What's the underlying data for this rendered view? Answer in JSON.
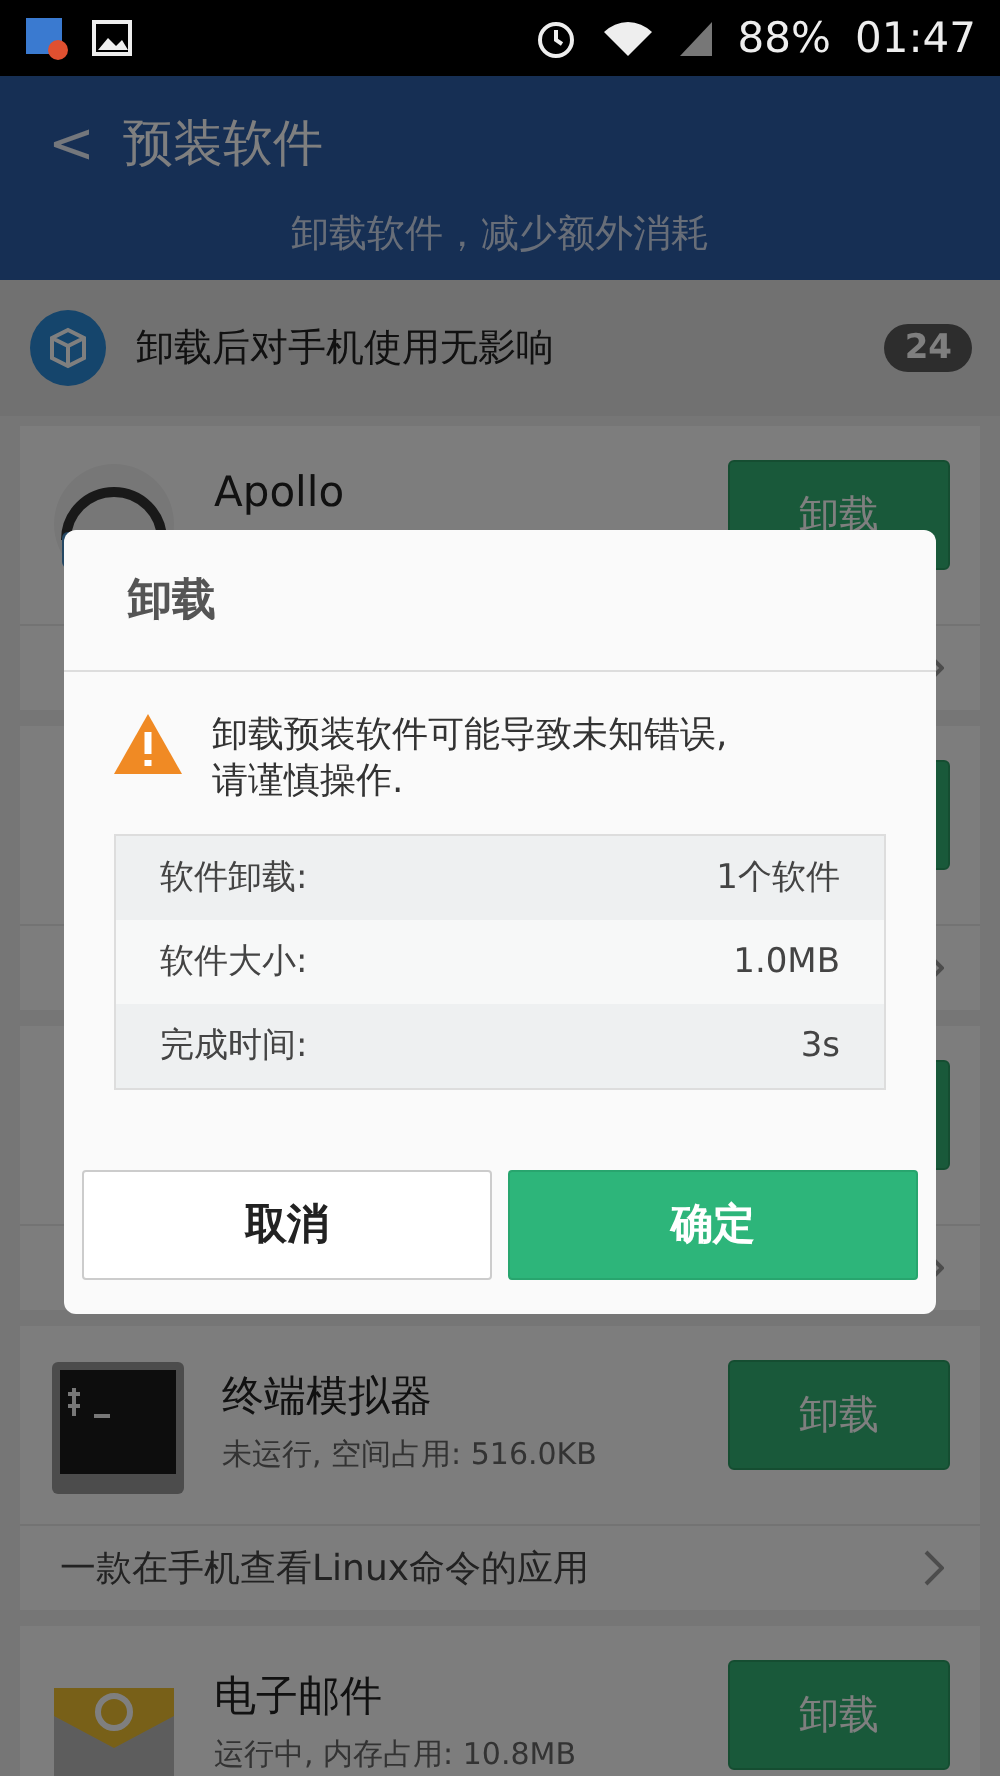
{
  "status_bar": {
    "battery": "88%",
    "time": "01:47"
  },
  "header": {
    "back": "<",
    "title": "预装软件",
    "subtitle": "卸载软件，减少额外消耗"
  },
  "section": {
    "title": "卸载后对手机使用无影响",
    "count": "24"
  },
  "apps": [
    {
      "kind": "headphones",
      "name": "Apollo",
      "button": "卸载"
    },
    {
      "kind": "covered"
    },
    {
      "kind": "covered"
    },
    {
      "kind": "terminal",
      "name": "终端模拟器",
      "detail": "未运行, 空间占用: 516.0KB",
      "button": "卸载",
      "description": "一款在手机查看Linux命令的应用"
    },
    {
      "kind": "mail",
      "name": "电子邮件",
      "detail": "运行中, 内存占用: 10.8MB",
      "button": "卸载"
    }
  ],
  "dialog": {
    "title": "卸载",
    "message": "卸载预装软件可能导致未知错误,\n请谨慎操作.",
    "rows": [
      {
        "label": "软件卸载:",
        "value": "1个软件"
      },
      {
        "label": "软件大小:",
        "value": "1.0MB"
      },
      {
        "label": "完成时间:",
        "value": "3s"
      }
    ],
    "buttons": [
      {
        "label": "取消",
        "kind": "secondary"
      },
      {
        "label": "确定",
        "kind": "primary"
      }
    ]
  }
}
